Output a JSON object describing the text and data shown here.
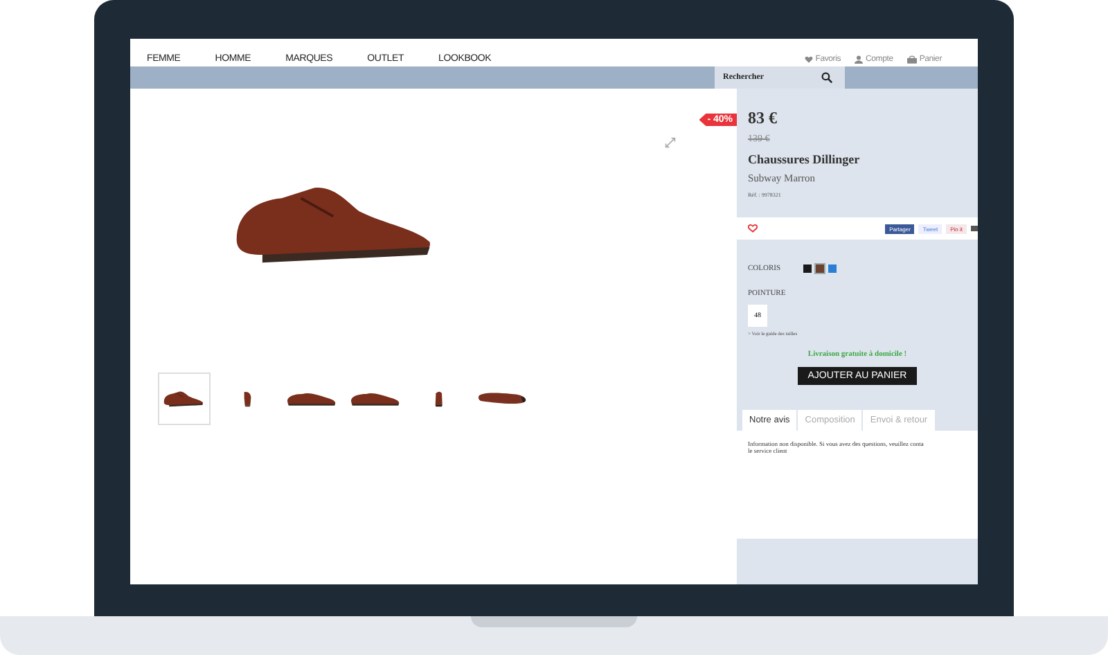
{
  "nav": {
    "items": [
      "FEMME",
      "HOMME",
      "MARQUES",
      "OUTLET",
      "LOOKBOOK"
    ],
    "user_links": [
      {
        "kind": "heart",
        "label": "Favoris"
      },
      {
        "kind": "person",
        "label": "Compte"
      },
      {
        "kind": "bag",
        "label": "Panier"
      }
    ]
  },
  "search": {
    "placeholder": "Rechercher"
  },
  "product": {
    "discount": "- 40%",
    "price": "83 €",
    "old_price": "139 €",
    "name": "Chaussures Dillinger",
    "subtitle": "Subway Marron",
    "reference": "Réf. : 9978321",
    "share_buttons": [
      {
        "kind": "facebook",
        "label": "Partager"
      },
      {
        "kind": "twitter",
        "label": "Tweet"
      },
      {
        "kind": "pinterest",
        "label": "Pin it"
      },
      {
        "kind": "email"
      }
    ],
    "colors_label": "COLORIS",
    "colors": [
      {
        "color": "#1a1a1a",
        "selected": false
      },
      {
        "color": "#6b4130",
        "selected": true
      },
      {
        "color": "#2a7fd4",
        "selected": false
      }
    ],
    "size_label": "POINTURE",
    "sizes": [
      "48"
    ],
    "size_guide": "> Voir le guide des tailles",
    "shipping": "Livraison gratuite à domicile !",
    "cart_button": "AJOUTER AU PANIER",
    "tabs": [
      {
        "label": "Notre avis",
        "selected": true
      },
      {
        "label": "Composition",
        "selected": false
      },
      {
        "label": "Envoi & retour",
        "selected": false
      }
    ],
    "tab_content": [
      "Information non disponible. Si vous avez des questions, veuillez conta",
      "le service client"
    ]
  },
  "thumbnails": [
    {
      "kind": "angled",
      "selected": true
    },
    {
      "kind": "front",
      "selected": false
    },
    {
      "kind": "side",
      "selected": false
    },
    {
      "kind": "side",
      "selected": false
    },
    {
      "kind": "back",
      "selected": false
    },
    {
      "kind": "sole",
      "selected": false
    }
  ]
}
